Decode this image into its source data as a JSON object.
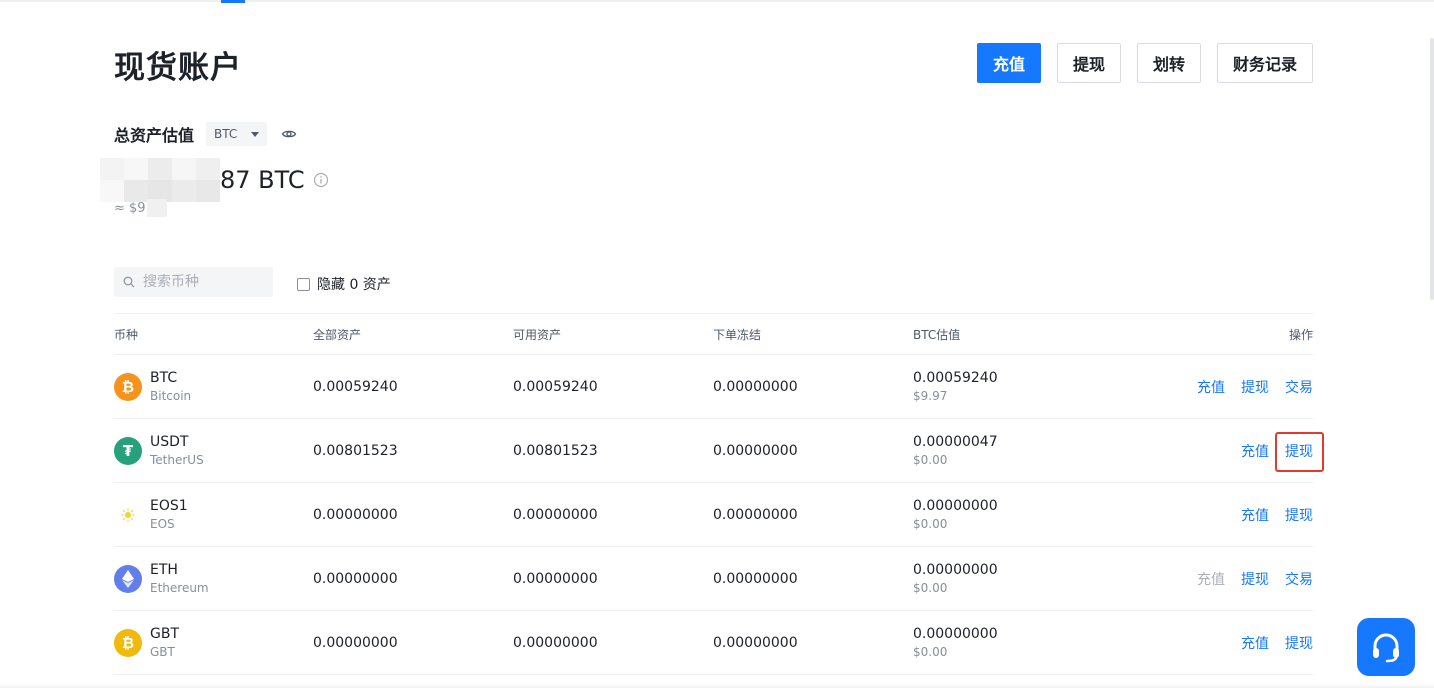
{
  "page": {
    "title": "现货账户"
  },
  "actions": {
    "deposit": "充值",
    "withdraw": "提现",
    "transfer": "划转",
    "records": "财务记录"
  },
  "summary": {
    "label": "总资产估值",
    "currency": "BTC",
    "balance_suffix": "87 BTC",
    "usd_prefix": "≈ $9"
  },
  "filter": {
    "search_placeholder": "搜索币种",
    "hide_zero_label": "隐藏 0 资产"
  },
  "table": {
    "headers": [
      "币种",
      "全部资产",
      "可用资产",
      "下单冻结",
      "BTC估值",
      "操作"
    ],
    "rows": [
      {
        "symbol": "BTC",
        "name": "Bitcoin",
        "total": "0.00059240",
        "available": "0.00059240",
        "frozen": "0.00000000",
        "btc_value": "0.00059240",
        "usd_value": "$9.97",
        "actions": [
          {
            "label": "充值",
            "state": "enabled"
          },
          {
            "label": "提现",
            "state": "enabled"
          },
          {
            "label": "交易",
            "state": "enabled"
          }
        ]
      },
      {
        "symbol": "USDT",
        "name": "TetherUS",
        "total": "0.00801523",
        "available": "0.00801523",
        "frozen": "0.00000000",
        "btc_value": "0.00000047",
        "usd_value": "$0.00",
        "actions": [
          {
            "label": "充值",
            "state": "enabled"
          },
          {
            "label": "提现",
            "state": "highlighted"
          }
        ]
      },
      {
        "symbol": "EOS1",
        "name": "EOS",
        "total": "0.00000000",
        "available": "0.00000000",
        "frozen": "0.00000000",
        "btc_value": "0.00000000",
        "usd_value": "$0.00",
        "actions": [
          {
            "label": "充值",
            "state": "enabled"
          },
          {
            "label": "提现",
            "state": "enabled"
          }
        ]
      },
      {
        "symbol": "ETH",
        "name": "Ethereum",
        "total": "0.00000000",
        "available": "0.00000000",
        "frozen": "0.00000000",
        "btc_value": "0.00000000",
        "usd_value": "$0.00",
        "actions": [
          {
            "label": "充值",
            "state": "disabled"
          },
          {
            "label": "提现",
            "state": "enabled"
          },
          {
            "label": "交易",
            "state": "enabled"
          }
        ]
      },
      {
        "symbol": "GBT",
        "name": "GBT",
        "total": "0.00000000",
        "available": "0.00000000",
        "frozen": "0.00000000",
        "btc_value": "0.00000000",
        "usd_value": "$0.00",
        "actions": [
          {
            "label": "充值",
            "state": "enabled"
          },
          {
            "label": "提现",
            "state": "enabled"
          }
        ]
      }
    ]
  },
  "colors": {
    "accent": "#1677ff",
    "highlight_border": "#e23b2e",
    "btc": "#f7931a",
    "usdt": "#26a17b",
    "eth": "#627eea",
    "gbt": "#f0b90b",
    "eos": "#f5d22a"
  },
  "icons": {
    "btc": "bitcoin-icon",
    "usdt": "tether-icon",
    "eos1": "eos-sun-icon",
    "eth": "ethereum-icon",
    "gbt": "gbt-coin-icon",
    "support": "headset-icon"
  }
}
